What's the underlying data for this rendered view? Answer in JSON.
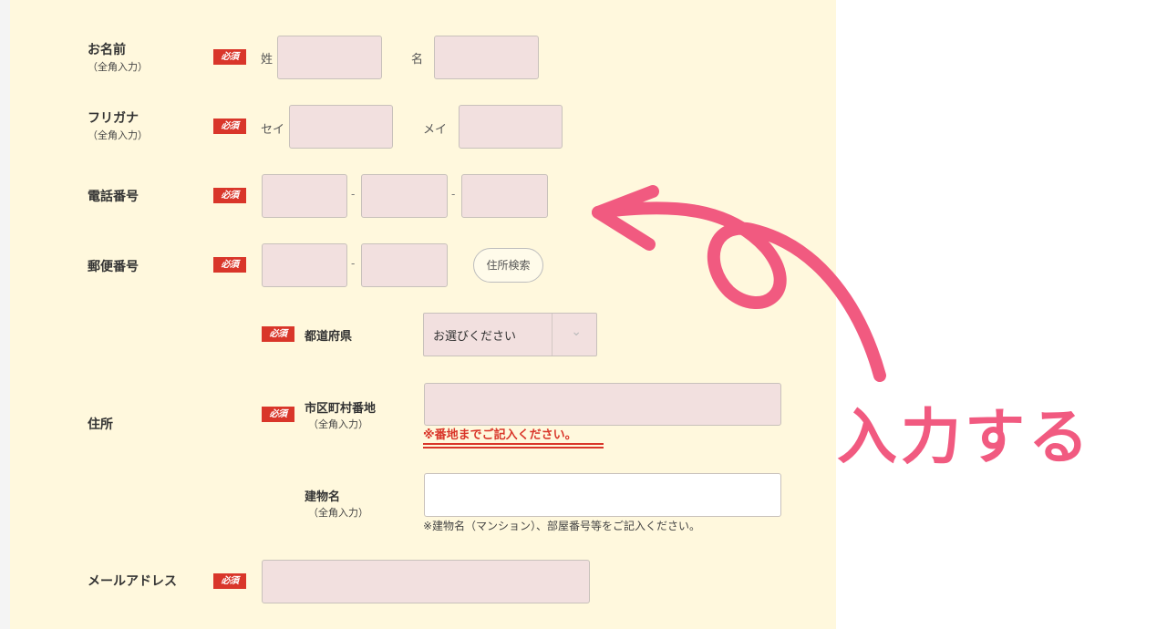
{
  "required_badge": "必須",
  "name": {
    "label": "お名前",
    "sub": "（全角入力）",
    "last_label": "姓",
    "first_label": "名"
  },
  "furigana": {
    "label": "フリガナ",
    "sub": "（全角入力）",
    "last_label": "セイ",
    "first_label": "メイ"
  },
  "phone": {
    "label": "電話番号",
    "separator": "-"
  },
  "postal": {
    "label": "郵便番号",
    "separator": "-",
    "search_button": "住所検索"
  },
  "address": {
    "label": "住所",
    "prefecture": {
      "label": "都道府県",
      "selected": "お選びください"
    },
    "city": {
      "label": "市区町村番地",
      "sub": "（全角入力）",
      "note": "※番地までご記入ください。"
    },
    "building": {
      "label": "建物名",
      "sub": "（全角入力）",
      "note": "※建物名（マンション）、部屋番号等をご記入ください。"
    }
  },
  "email": {
    "label": "メールアドレス"
  },
  "annotation": {
    "text": "入力する",
    "color": "#f15a80"
  },
  "colors": {
    "panel": "#fff8dd",
    "badge": "#d9362a",
    "field": "#f2e0df"
  }
}
